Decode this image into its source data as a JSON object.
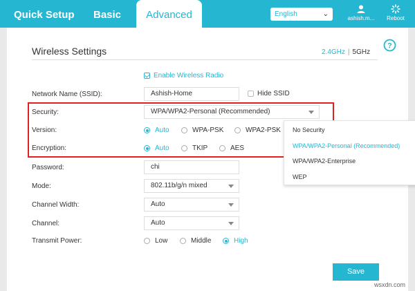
{
  "header": {
    "tabs": [
      {
        "label": "Quick Setup"
      },
      {
        "label": "Basic"
      },
      {
        "label": "Advanced"
      }
    ],
    "language": "English",
    "username": "ashish.m...",
    "reboot_label": "Reboot"
  },
  "section": {
    "title": "Wireless Settings",
    "band_24": "2.4GHz",
    "band_sep": "|",
    "band_5": "5GHz"
  },
  "form": {
    "enable_radio_label": "Enable Wireless Radio",
    "enable_radio_checked": true,
    "ssid_label": "Network Name (SSID):",
    "ssid_value": "Ashish-Home",
    "hide_ssid_label": "Hide SSID",
    "hide_ssid_checked": false,
    "security_label": "Security:",
    "security_value": "WPA/WPA2-Personal (Recommended)",
    "version_label": "Version:",
    "version_options": [
      "Auto",
      "WPA-PSK",
      "WPA2-PSK"
    ],
    "version_selected": "Auto",
    "encryption_label": "Encryption:",
    "encryption_options": [
      "Auto",
      "TKIP",
      "AES"
    ],
    "encryption_selected": "Auto",
    "password_label": "Password:",
    "password_value": "chi",
    "mode_label": "Mode:",
    "mode_value": "802.11b/g/n mixed",
    "channel_width_label": "Channel Width:",
    "channel_width_value": "Auto",
    "channel_label": "Channel:",
    "channel_value": "Auto",
    "transmit_label": "Transmit Power:",
    "transmit_options": [
      "Low",
      "Middle",
      "High"
    ],
    "transmit_selected": "High"
  },
  "security_dropdown": {
    "options": [
      "No Security",
      "WPA/WPA2-Personal (Recommended)",
      "WPA/WPA2-Enterprise",
      "WEP"
    ],
    "highlighted": "WPA/WPA2-Personal (Recommended)"
  },
  "save_label": "Save",
  "watermark": "wsxdn.com",
  "colors": {
    "accent": "#25b6d2",
    "highlight_border": "#e02020"
  }
}
